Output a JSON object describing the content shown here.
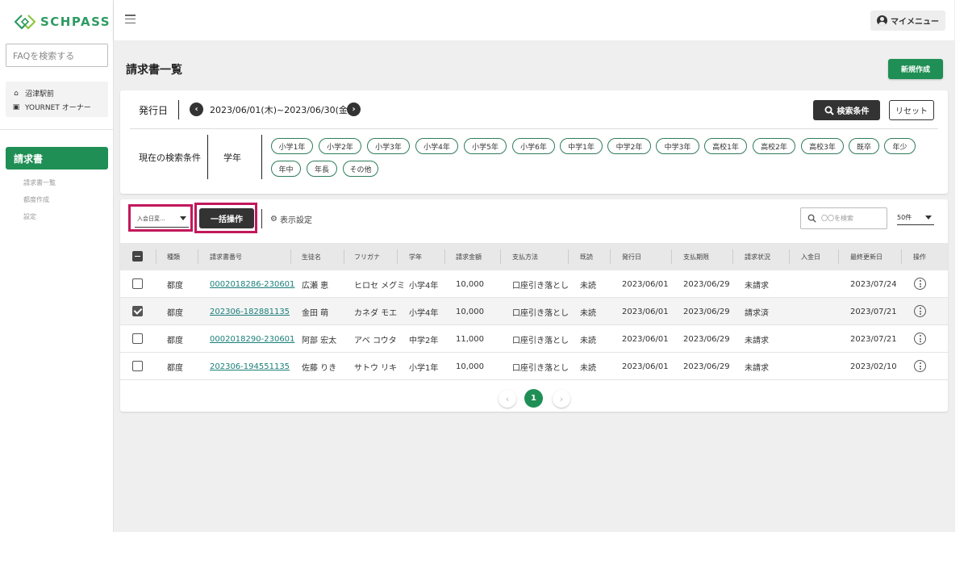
{
  "brand": {
    "name": "SCHPASS",
    "color": "#1f8f55"
  },
  "sidebar": {
    "faq_placeholder": "FAQを検索する",
    "user": {
      "school": "沼津駅前",
      "role": "YOURNET オーナー"
    },
    "active_item": "請求書",
    "sub_items": [
      "請求書一覧",
      "都度作成",
      "設定"
    ]
  },
  "topbar": {
    "mymenu_label": "マイメニュー"
  },
  "page": {
    "title": "請求書一覧",
    "new_button": "新規作成"
  },
  "filter": {
    "issue_label": "発行日",
    "date_range": "2023/06/01(木)~2023/06/30(金)",
    "search_button": "検索条件",
    "reset_button": "リセット",
    "current_label": "現在の検索条件",
    "grade_label": "学年",
    "chips": [
      "小学1年",
      "小学2年",
      "小学3年",
      "小学4年",
      "小学5年",
      "小学6年",
      "中学1年",
      "中学2年",
      "中学3年",
      "高校1年",
      "高校2年",
      "高校3年",
      "既卒",
      "年少",
      "年中",
      "年長",
      "その他"
    ]
  },
  "table_toolbar": {
    "select_value": "入会日変...",
    "bulk_button": "一括操作",
    "display_settings": "表示設定",
    "search_placeholder": "〇〇を検索",
    "per_page": "50件"
  },
  "table": {
    "headers": [
      "種類",
      "請求書番号",
      "生徒名",
      "フリガナ",
      "学年",
      "請求金額",
      "支払方法",
      "既読",
      "発行日",
      "支払期限",
      "請求状況",
      "入金日",
      "最終更新日",
      "操作"
    ],
    "rows": [
      {
        "checked": false,
        "type": "都度",
        "invoice_no": "0002018286-230601",
        "student": "広瀬 恵",
        "kana": "ヒロセ メグミ",
        "grade": "小学4年",
        "amount": "10,000",
        "payment": "口座引き落とし",
        "read": "未読",
        "issued": "2023/06/01",
        "due": "2023/06/29",
        "status": "未請求",
        "paid_date": "",
        "updated": "2023/07/24"
      },
      {
        "checked": true,
        "type": "都度",
        "invoice_no": "202306-182881135",
        "student": "金田 萌",
        "kana": "カネダ モエ",
        "grade": "小学4年",
        "amount": "10,000",
        "payment": "口座引き落とし",
        "read": "未読",
        "issued": "2023/06/01",
        "due": "2023/06/29",
        "status": "請求済",
        "paid_date": "",
        "updated": "2023/07/21"
      },
      {
        "checked": false,
        "type": "都度",
        "invoice_no": "0002018290-230601",
        "student": "阿部 宏太",
        "kana": "アベ コウタ",
        "grade": "中学2年",
        "amount": "11,000",
        "payment": "口座引き落とし",
        "read": "未読",
        "issued": "2023/06/01",
        "due": "2023/06/29",
        "status": "未請求",
        "paid_date": "",
        "updated": "2023/07/21"
      },
      {
        "checked": false,
        "type": "都度",
        "invoice_no": "202306-194551135",
        "student": "佐藤 りき",
        "kana": "サトウ リキ",
        "grade": "小学1年",
        "amount": "10,000",
        "payment": "口座引き落とし",
        "read": "未読",
        "issued": "2023/06/01",
        "due": "2023/06/29",
        "status": "未請求",
        "paid_date": "",
        "updated": "2023/02/10"
      }
    ]
  },
  "pagination": {
    "current": "1",
    "prev": "‹",
    "next": "›"
  },
  "highlight_color": "#c2185b"
}
